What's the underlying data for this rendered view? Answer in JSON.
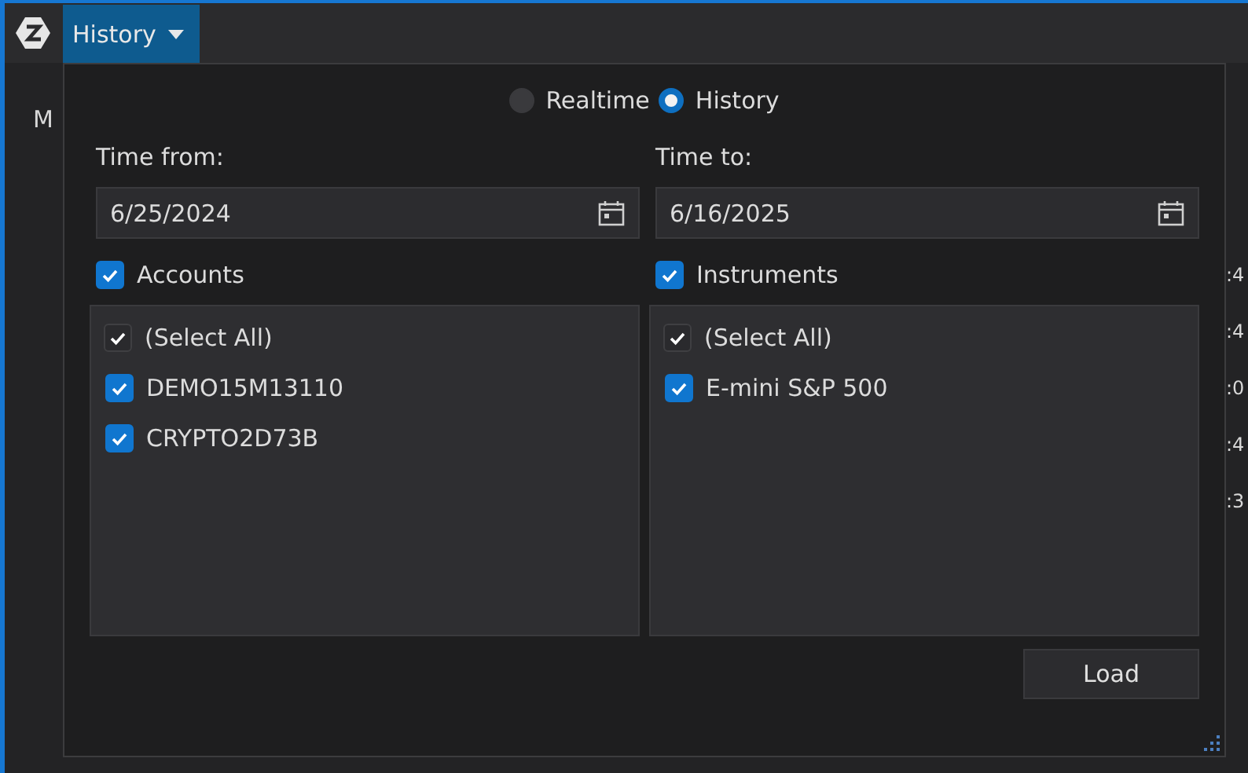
{
  "menu_button": {
    "label": "History"
  },
  "background": {
    "tab_label": "M",
    "cell_fragments": [
      ":4",
      ":4",
      ":0",
      ":4",
      ":3"
    ]
  },
  "mode": [
    {
      "label": "Realtime",
      "selected": false
    },
    {
      "label": "History",
      "selected": true
    }
  ],
  "time_from": {
    "label": "Time from:",
    "value": "6/25/2024"
  },
  "time_to": {
    "label": "Time to:",
    "value": "6/16/2025"
  },
  "accounts": {
    "label": "Accounts",
    "checked": true,
    "items": [
      {
        "label": "(Select All)",
        "kind": "select_all",
        "checked": true
      },
      {
        "label": "DEMO15M13110",
        "kind": "item",
        "checked": true
      },
      {
        "label": "CRYPTO2D73B",
        "kind": "item",
        "checked": true
      }
    ]
  },
  "instruments": {
    "label": "Instruments",
    "checked": true,
    "items": [
      {
        "label": "(Select All)",
        "kind": "select_all",
        "checked": true
      },
      {
        "label": "E-mini S&P 500",
        "kind": "item",
        "checked": true
      }
    ]
  },
  "load_button": {
    "label": "Load"
  }
}
